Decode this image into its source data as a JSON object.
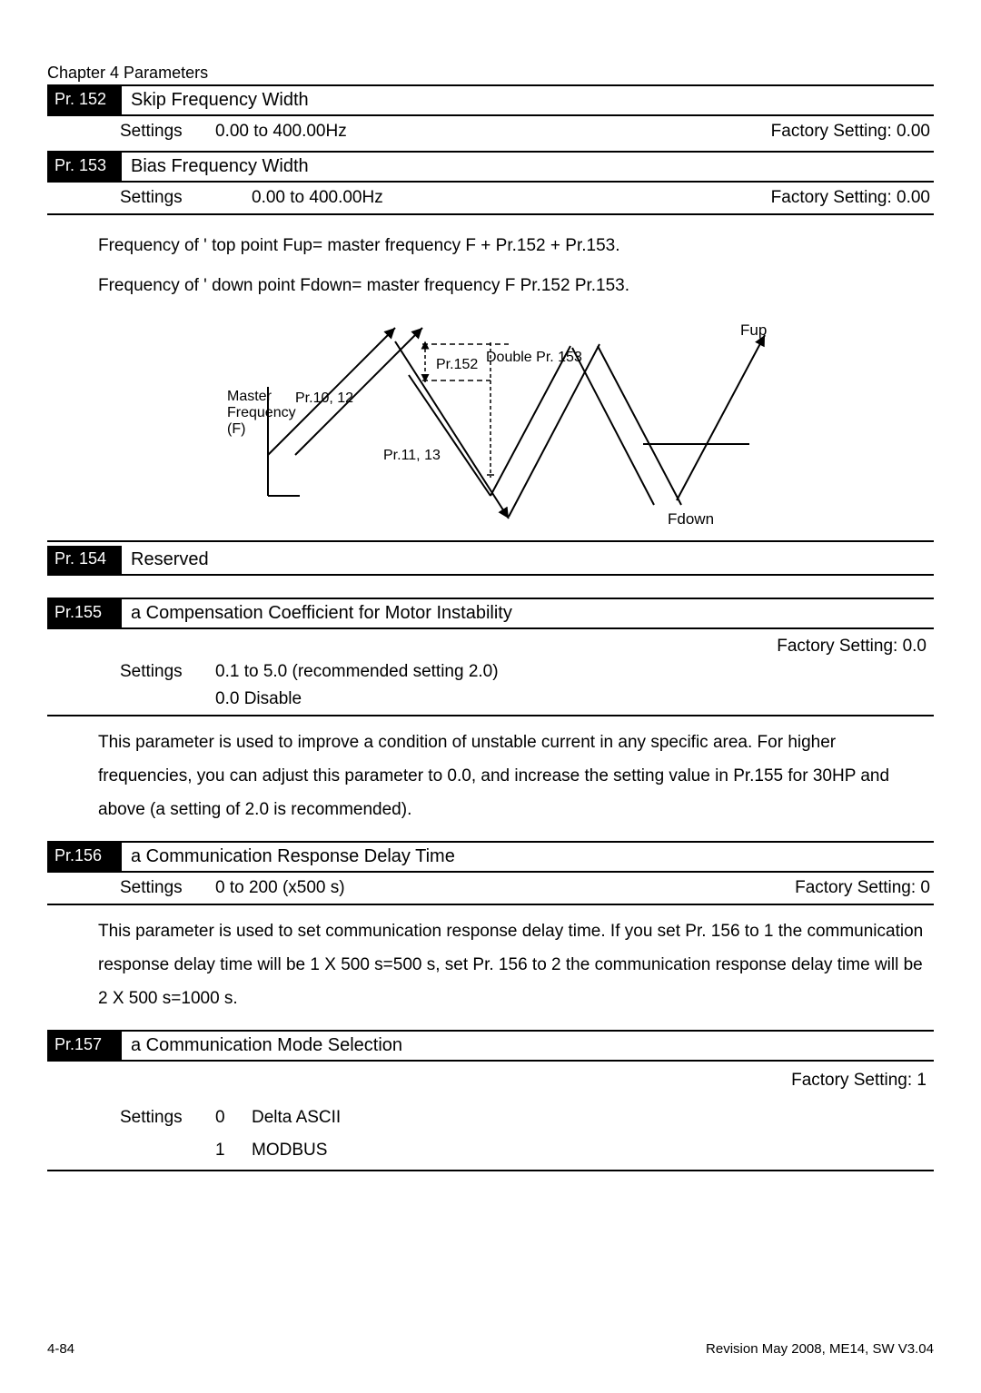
{
  "chapter": "Chapter 4 Parameters",
  "pr152": {
    "label": "Pr. 152",
    "title": "Skip Frequency Width",
    "settings_label": "Settings",
    "settings_value": "0.00 to 400.00Hz",
    "factory": "Factory Setting: 0.00"
  },
  "pr153": {
    "label": "Pr. 153",
    "title": "Bias Frequency Width",
    "settings_label": "Settings",
    "settings_value": "0.00 to 400.00Hz",
    "factory": "Factory Setting: 0.00"
  },
  "body_freq": {
    "line1": "Frequency of ' top point Fup= master frequency F + Pr.152 + Pr.153.",
    "line2": "Frequency of ' down point Fdown= master frequency F   Pr.152   Pr.153."
  },
  "diagram": {
    "master_l1": "Master",
    "master_l2": "Frequency",
    "master_l3": "(F)",
    "pr1012": "Pr.10, 12",
    "pr152": "Pr.152",
    "double153": "Double Pr. 153",
    "pr1113": "Pr.11, 13",
    "fup": "Fup",
    "fdown": "Fdown"
  },
  "pr154": {
    "label": "Pr. 154",
    "title": "Reserved"
  },
  "pr155": {
    "label": "Pr.155",
    "title": "a  Compensation Coefficient for Motor Instability",
    "factory": "Factory Setting: 0.0",
    "settings_label": "Settings",
    "settings_value": "0.1 to 5.0 (recommended setting 2.0)",
    "settings_value2": "0.0 Disable",
    "desc": "This parameter is used to improve a condition of unstable current in any specific area. For higher frequencies, you can adjust this parameter to 0.0, and increase the setting value in Pr.155 for 30HP and above (a setting of 2.0 is recommended)."
  },
  "pr156": {
    "label": "Pr.156",
    "title": "a Communication Response Delay Time",
    "settings_label": "Settings",
    "settings_value": "0 to 200 (x500 s)",
    "factory": "Factory Setting: 0",
    "desc": "This parameter is used to set communication response delay time. If you set Pr. 156 to 1 the communication response delay time will be 1 X 500 s=500 s, set Pr. 156 to 2 the communication response delay time will be 2 X 500 s=1000 s."
  },
  "pr157": {
    "label": "Pr.157",
    "title": "a  Communication Mode Selection",
    "factory": "Factory Setting: 1",
    "settings_label": "Settings",
    "opt0_num": "0",
    "opt0_val": "Delta ASCII",
    "opt1_num": "1",
    "opt1_val": "MODBUS"
  },
  "footer": {
    "left": "4-84",
    "right": "Revision May 2008, ME14, SW V3.04"
  }
}
